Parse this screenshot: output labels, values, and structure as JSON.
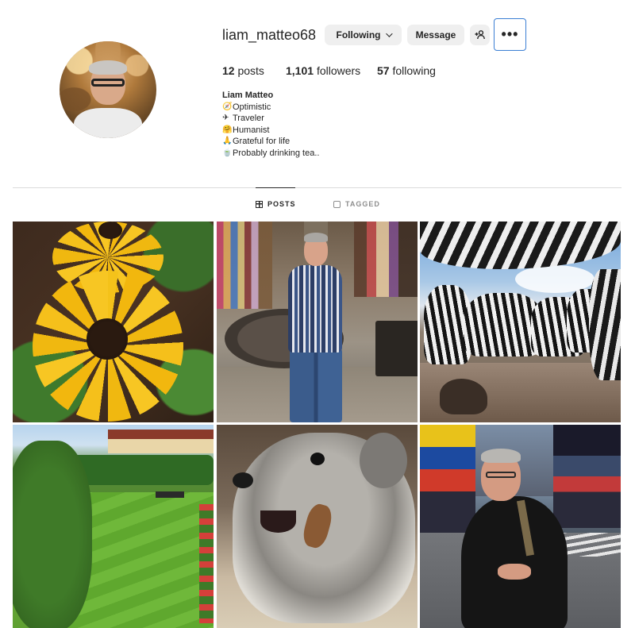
{
  "profile": {
    "username": "liam_matteo68",
    "following_button": "Following",
    "message_button": "Message",
    "more_button": "•••",
    "stats": {
      "posts_count": "12",
      "posts_label": "posts",
      "followers_count": "1,101",
      "followers_label": "followers",
      "following_count": "57",
      "following_label": "following"
    },
    "full_name": "Liam Matteo",
    "bio": [
      {
        "emoji": "🧭",
        "text": "Optimistic"
      },
      {
        "emoji": "✈",
        "text": "Traveler"
      },
      {
        "emoji": "🤗",
        "text": "Humanist"
      },
      {
        "emoji": "🙏",
        "text": "Grateful for life"
      },
      {
        "emoji": "🍵",
        "text": "Probably drinking tea.."
      }
    ]
  },
  "tabs": {
    "posts": "POSTS",
    "tagged": "TAGGED"
  },
  "icons": {
    "add_user": "add-person-icon",
    "posts_tab": "grid-icon",
    "tagged_tab": "tag-person-icon",
    "following_dropdown": "chevron-down-icon"
  },
  "colors": {
    "button_bg": "#efefef",
    "focus_outline": "#3b7fd4",
    "text": "#262626",
    "muted": "#8e8e8e"
  },
  "posts": [
    {
      "subject": "yellow flowers"
    },
    {
      "subject": "man in plaid shirt in courtyard"
    },
    {
      "subject": "herd of zebras"
    },
    {
      "subject": "garden lawn"
    },
    {
      "subject": "schnauzer dog chewing"
    },
    {
      "subject": "man in Times Square"
    }
  ]
}
